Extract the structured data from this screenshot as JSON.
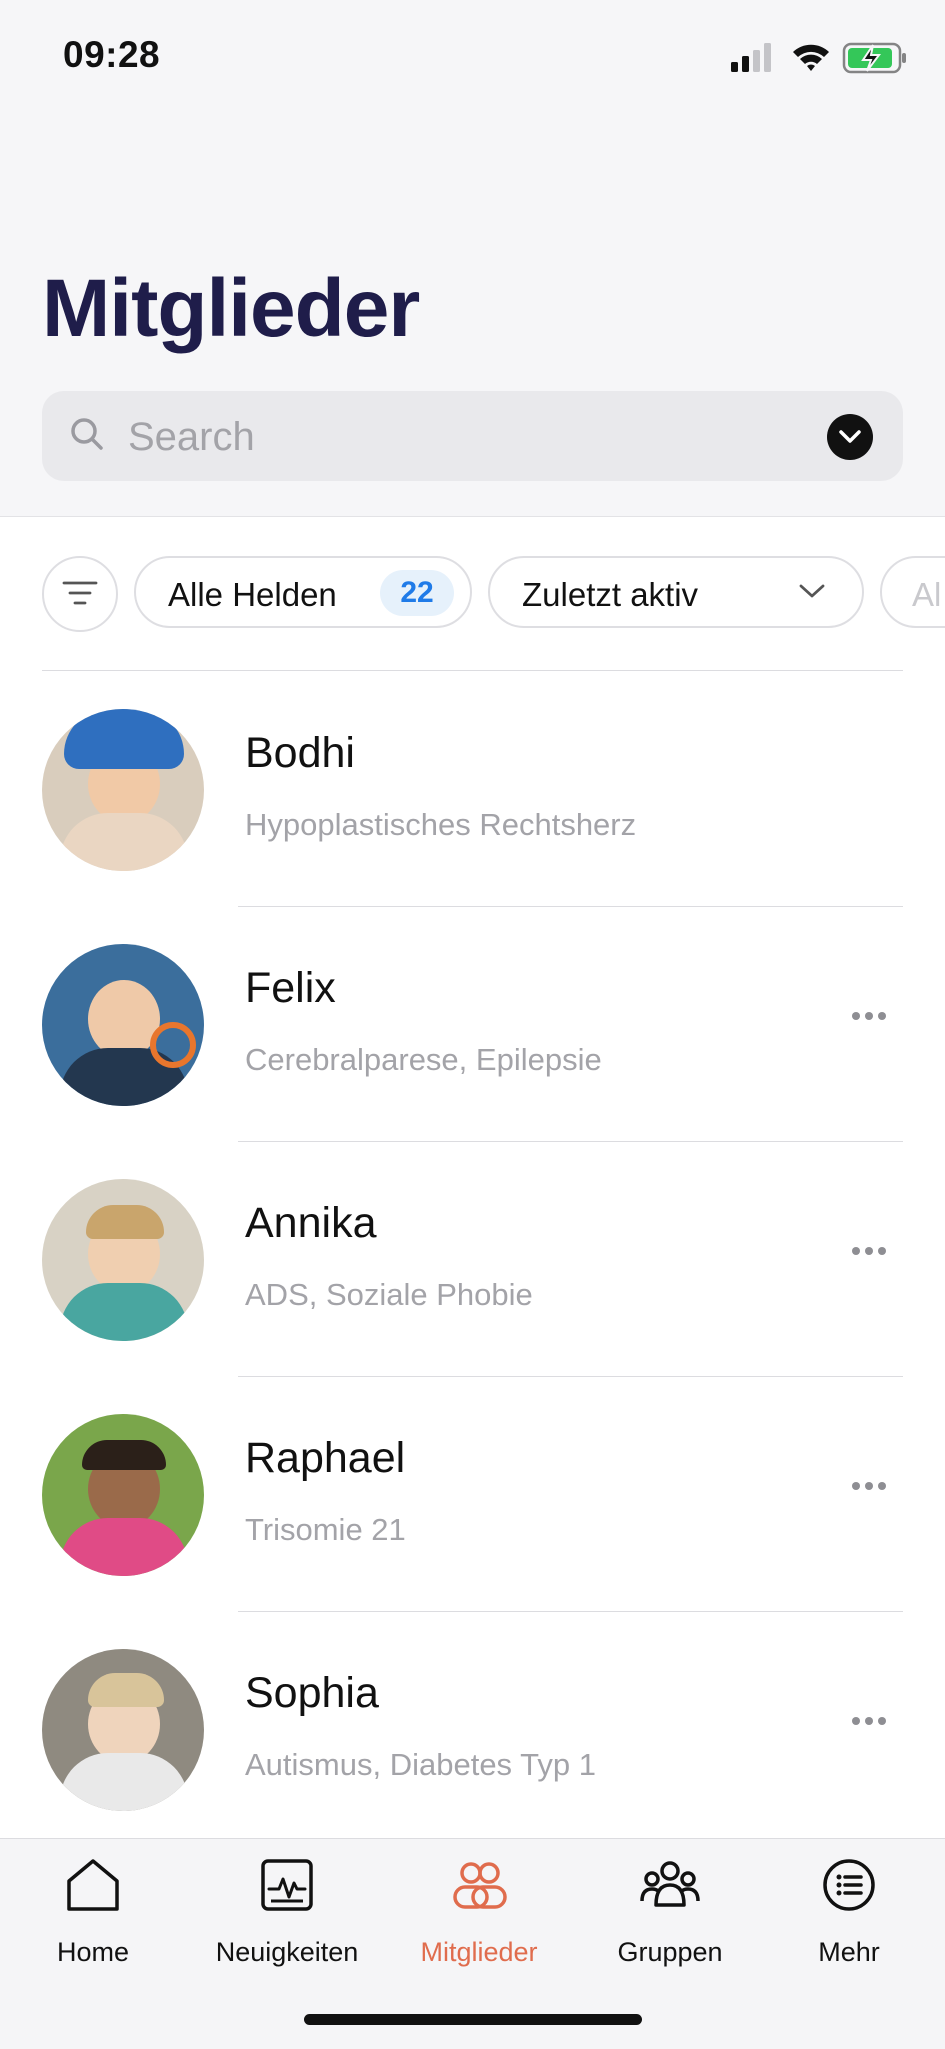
{
  "status_bar": {
    "time": "09:28"
  },
  "header": {
    "title": "Mitglieder"
  },
  "search": {
    "placeholder": "Search"
  },
  "filters": {
    "all_label": "Alle Helden",
    "all_count": "22",
    "sort_label": "Zuletzt aktiv",
    "extra_label": "Al"
  },
  "members": [
    {
      "name": "Bodhi",
      "condition": "Hypoplastisches Rechtsherz",
      "has_menu": false
    },
    {
      "name": "Felix",
      "condition": "Cerebralparese, Epilepsie",
      "has_menu": true
    },
    {
      "name": "Annika",
      "condition": "ADS, Soziale Phobie",
      "has_menu": true
    },
    {
      "name": "Raphael",
      "condition": "Trisomie 21",
      "has_menu": true
    },
    {
      "name": "Sophia",
      "condition": "Autismus, Diabetes Typ 1",
      "has_menu": true
    }
  ],
  "tab_bar": {
    "tabs": [
      {
        "label": "Home",
        "icon": "home-icon"
      },
      {
        "label": "Neuigkeiten",
        "icon": "activity-icon"
      },
      {
        "label": "Mitglieder",
        "icon": "members-icon"
      },
      {
        "label": "Gruppen",
        "icon": "groups-icon"
      },
      {
        "label": "Mehr",
        "icon": "menu-list-icon"
      }
    ],
    "active_tab": "Mitglieder",
    "active_color": "#e06c4d"
  },
  "colors": {
    "title": "#1f1d4a",
    "count_badge_bg": "#e6f1fb",
    "count_badge_text": "#1f7be8",
    "subtitle_text": "#a3a3a8"
  }
}
